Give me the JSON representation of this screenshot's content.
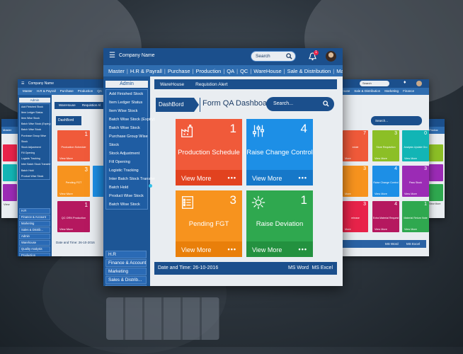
{
  "app": {
    "company_name": "Company Name",
    "search_placeholder": "Search",
    "notification_count": "1"
  },
  "menu": [
    "Master",
    "H.R & Payrall",
    "Purchase",
    "Production",
    "QA",
    "QC",
    "WareHouse",
    "Sale & Distribution",
    "Marketing",
    "Finance"
  ],
  "sidebar": {
    "header": "Admin",
    "items": [
      "Add Finished Stock",
      "Item Ledger Status",
      "Item Wise Stock",
      "Batch Wise Stock (Expiry)",
      "Batch Wise Stock",
      "Purchase Group Wise",
      "Stock",
      "Stock Adjustment",
      "Fill Opening",
      "Logistic Tracking",
      "Inter Batch Stock Transfer",
      "Batch Hold",
      "Product Wise Stock",
      "Batch Wise Stock"
    ],
    "modules": [
      "H.R",
      "Finance & Account",
      "Marketing",
      "Sales & Distrib...",
      "Admin",
      "Warehouse",
      "Quality Analysis",
      "Production"
    ]
  },
  "tabs": [
    "WareHouse",
    "Requistion Alert"
  ],
  "dashboard": {
    "button": "DashBord",
    "title": "Form QA Dashboard",
    "search_placeholder": "Search..."
  },
  "tiles": [
    {
      "title": "Production Schedule",
      "count": "1",
      "footer": "View More",
      "color": "#f05a3a",
      "footer_color": "#e2421f",
      "icon": "factory-icon"
    },
    {
      "title": "Raise Change Control",
      "count": "4",
      "footer": "View More",
      "color": "#1d8fe6",
      "footer_color": "#1678c9",
      "icon": "sliders-icon"
    },
    {
      "title": "Pending FGT",
      "count": "3",
      "footer": "View More",
      "color": "#f7931e",
      "footer_color": "#e97f0a",
      "icon": "checklist-icon"
    },
    {
      "title": "Raise Deviation",
      "count": "1",
      "footer": "View More",
      "color": "#2fa84f",
      "footer_color": "#23913f",
      "icon": "gear-cycle-icon"
    }
  ],
  "status": {
    "datetime": "Date and Time: 26-10-2016",
    "word": "MS Word",
    "excel": "MS Excel"
  },
  "left_panel": {
    "company_name": "Company Name",
    "menu": [
      "Master",
      "H.R & Payrall",
      "Purchase",
      "Production",
      "QA"
    ],
    "sidebar_header": "Admin",
    "sidebar_items": [
      "Add Finished Stock",
      "Item Ledger Status",
      "Item Wise Stock",
      "Batch Wise Stock (Expiry)",
      "Batch Wise Stock",
      "Purchase Group Wise",
      "Stock",
      "Stock Adjustment",
      "Fill Opening",
      "Logistic Tracking",
      "Inter Batch Stock Transfer",
      "Batch Hold",
      "Product Wise Stock"
    ],
    "modules": [
      "H.R",
      "Finance & Account",
      "Marketing",
      "Sales & Distrib...",
      "Admin",
      "Warehouse",
      "Quality Analysis",
      "Production"
    ],
    "tab": "WareHouse",
    "tab2": "Requistion Al",
    "dash": "DashBord",
    "tiles": [
      {
        "title": "Production Schedule",
        "count": "1",
        "footer": "View More",
        "color": "#f05a3a"
      },
      {
        "title": "Pending FGT",
        "count": "3",
        "footer": "View More",
        "color": "#f7931e"
      },
      {
        "title": "QC ORN Production",
        "count": "1",
        "footer": "View More",
        "color": "#b5185f"
      }
    ],
    "datetime": "Date and Time: 26-10-2016"
  },
  "right_panel": {
    "search": "Search",
    "menu": [
      "rouse",
      "Sale & Distribution",
      "Marketing",
      "Finance"
    ],
    "search2": "Search...",
    "tiles": [
      {
        "title": "edule",
        "count": "7",
        "footer": "More",
        "color": "#f05a3a"
      },
      {
        "title": "Store Requisition",
        "count": "3",
        "footer": "View More",
        "color": "#8cbf26"
      },
      {
        "title": "Analysis Update Gro",
        "count": "0",
        "footer": "View More",
        "color": "#12b5b5"
      },
      {
        "title": "",
        "count": "3",
        "footer": "More",
        "color": "#f7931e"
      },
      {
        "title": "Raise Change Control",
        "count": "4",
        "footer": "View More",
        "color": "#1d8fe6"
      },
      {
        "title": "Pass Stock",
        "count": "3",
        "footer": "View More",
        "color": "#9b2bb5"
      },
      {
        "title": "release",
        "count": "3",
        "footer": "More",
        "color": "#e8234a"
      },
      {
        "title": "Extra Material Request",
        "count": "4",
        "footer": "View More",
        "color": "#b5185f"
      },
      {
        "title": "Material Return Note",
        "count": "1",
        "footer": "View More",
        "color": "#2fa84f"
      }
    ],
    "word": "MS Word",
    "excel": "MS Excel"
  },
  "far_left_panel": {
    "menu": "Master",
    "tile_footer": "View"
  },
  "far_right_panel": {
    "menu": "Produc",
    "tile_footer": "View More"
  }
}
